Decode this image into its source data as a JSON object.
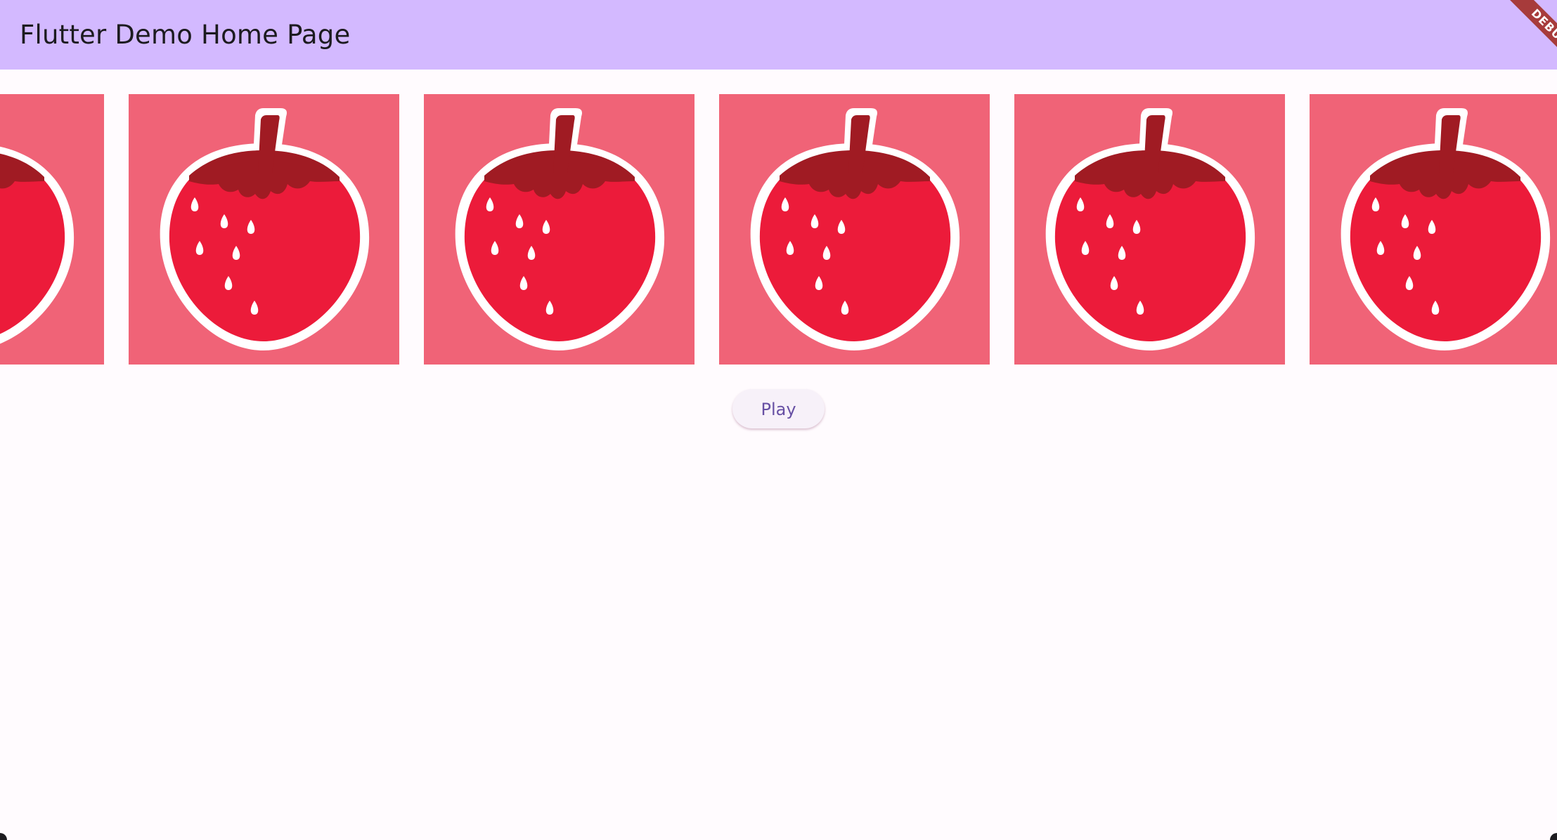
{
  "appbar": {
    "title": "Flutter Demo Home Page",
    "background": "#d3b9ff"
  },
  "debug_banner": {
    "label": "DEBUG",
    "color": "#a73b3b"
  },
  "carousel": {
    "tile_background": "#f06377",
    "tile_count": 6,
    "tile_icon": "strawberry-icon",
    "strawberry_colors": {
      "body": "#ec1b3a",
      "leaves": "#a01b23",
      "outline": "#ffffff",
      "seeds": "#ffffff"
    }
  },
  "controls": {
    "play_label": "Play",
    "play_text_color": "#6750a4"
  },
  "page": {
    "background": "#fffbfe"
  }
}
